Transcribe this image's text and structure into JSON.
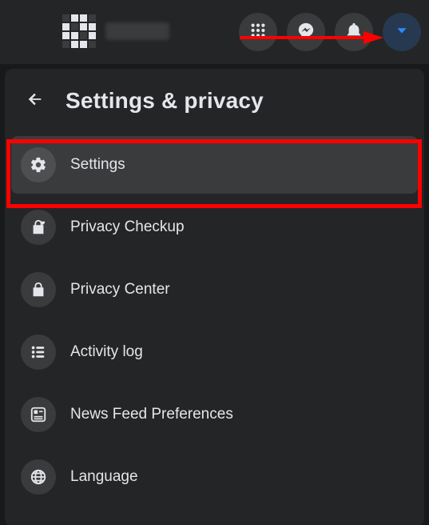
{
  "panel": {
    "title": "Settings & privacy"
  },
  "menu": {
    "items": [
      {
        "icon": "gear-icon",
        "label": "Settings"
      },
      {
        "icon": "lock-heart-icon",
        "label": "Privacy Checkup"
      },
      {
        "icon": "lock-icon",
        "label": "Privacy Center"
      },
      {
        "icon": "list-icon",
        "label": "Activity log"
      },
      {
        "icon": "feed-icon",
        "label": "News Feed Preferences"
      },
      {
        "icon": "globe-icon",
        "label": "Language"
      }
    ]
  },
  "annotation": {
    "highlight_index": 0,
    "arrow_color": "#ff0000",
    "highlight_color": "#ff0000"
  }
}
